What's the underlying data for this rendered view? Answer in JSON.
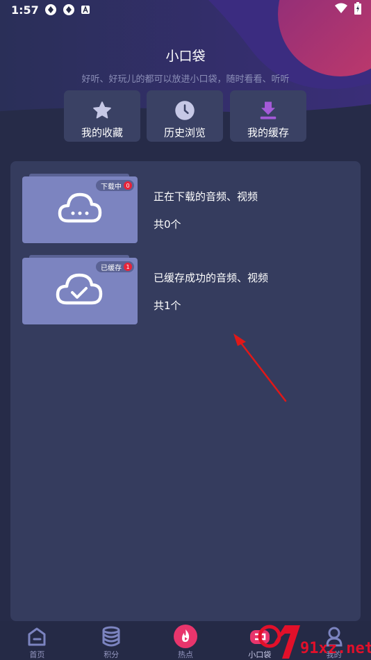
{
  "status_bar": {
    "time": "1:57"
  },
  "header": {
    "title": "小口袋",
    "subtitle": "好听、好玩儿的都可以放进小口袋，随时看看、听听"
  },
  "quick_actions": [
    {
      "label": "我的收藏",
      "icon": "star-icon"
    },
    {
      "label": "历史浏览",
      "icon": "clock-icon"
    },
    {
      "label": "我的缓存",
      "icon": "download-icon"
    }
  ],
  "lists": [
    {
      "badge": "下载中",
      "badge_count": "0",
      "title": "正在下载的音频、视频",
      "count": "共0个",
      "icon": "cloud-dots-icon"
    },
    {
      "badge": "已缓存",
      "badge_count": "1",
      "title": "已缓存成功的音频、视频",
      "count": "共1个",
      "icon": "cloud-check-icon"
    }
  ],
  "tabs": [
    {
      "label": "首页",
      "icon": "home-icon"
    },
    {
      "label": "积分",
      "icon": "coins-icon"
    },
    {
      "label": "热点",
      "icon": "hot-play-icon"
    },
    {
      "label": "小口袋",
      "icon": "pocket-icon"
    },
    {
      "label": "我的",
      "icon": "profile-icon"
    }
  ],
  "watermark": {
    "text": "91xz.net"
  },
  "colors": {
    "background": "#262b48",
    "panel": "#353c5e",
    "folder": "#7c84c0",
    "accent_purple": "#a45ad8",
    "accent_pink": "#e8356c",
    "badge_red": "#e8243a"
  }
}
